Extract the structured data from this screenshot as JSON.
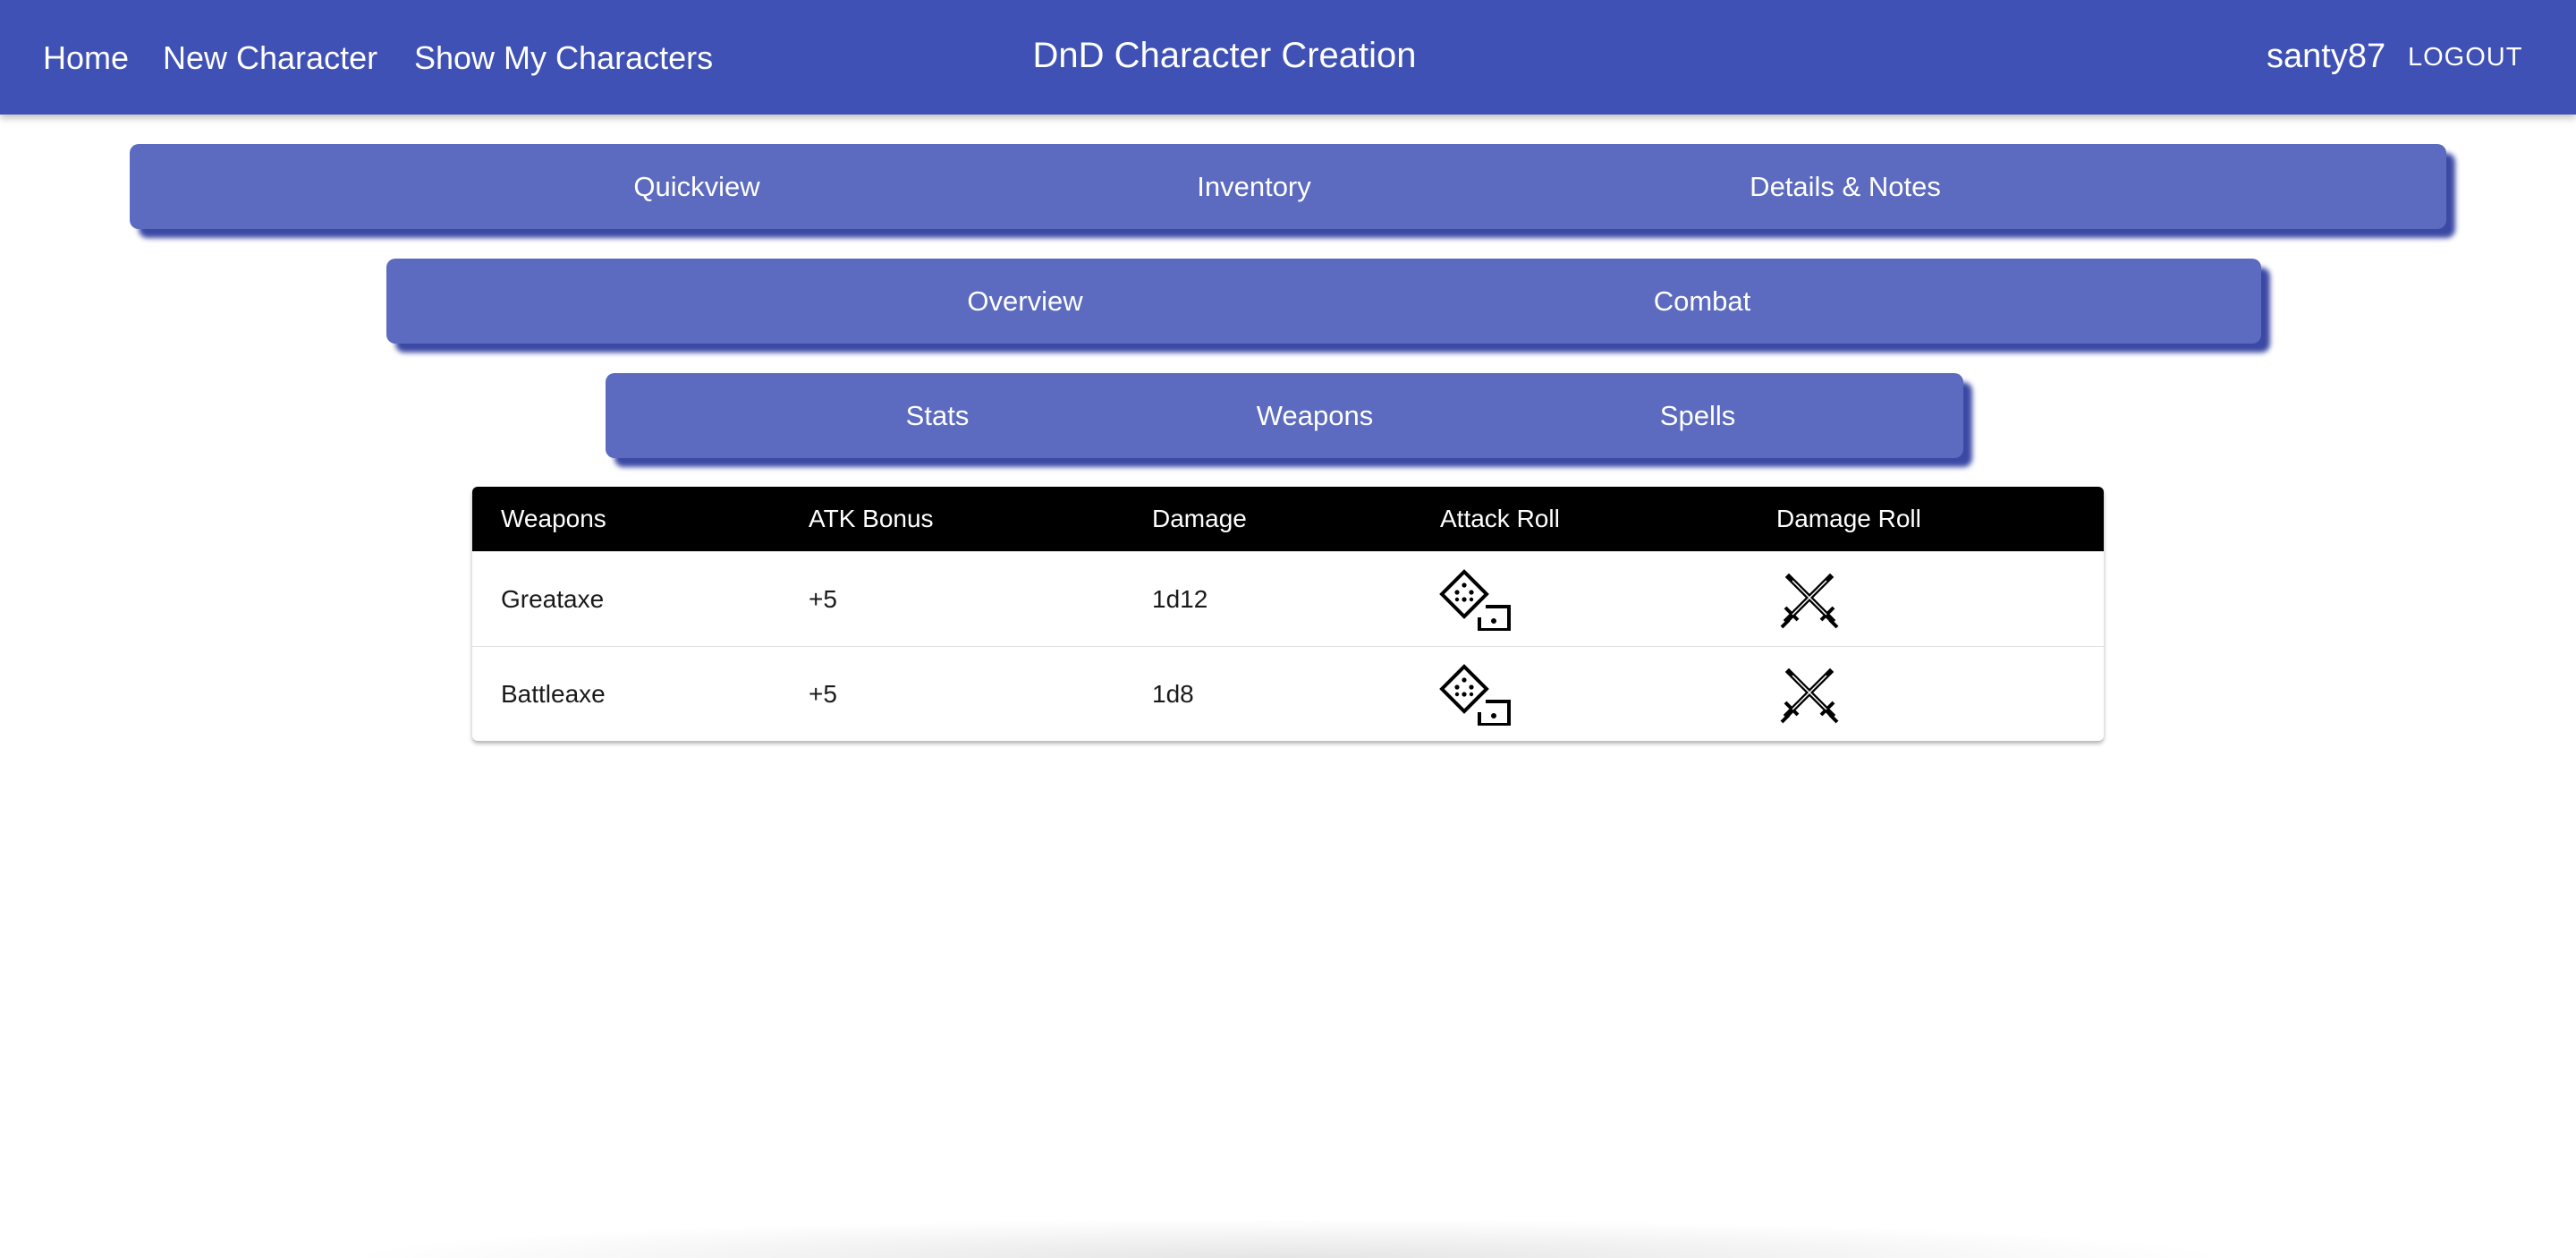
{
  "appbar": {
    "nav": [
      {
        "label": "Home"
      },
      {
        "label": "New Character"
      },
      {
        "label": "Show My Characters"
      }
    ],
    "title": "DnD Character Creation",
    "username": "santy87",
    "logout_label": "LOGOUT",
    "color": "#3f51b5"
  },
  "tabs_primary": [
    {
      "label": "Quickview"
    },
    {
      "label": "Inventory"
    },
    {
      "label": "Details & Notes"
    }
  ],
  "tabs_secondary": [
    {
      "label": "Overview"
    },
    {
      "label": "Combat"
    }
  ],
  "tabs_tertiary": [
    {
      "label": "Stats"
    },
    {
      "label": "Weapons"
    },
    {
      "label": "Spells"
    }
  ],
  "tab_color": "#5c6bc0",
  "weapons_table": {
    "headers": [
      "Weapons",
      "ATK Bonus",
      "Damage",
      "Attack Roll",
      "Damage Roll"
    ],
    "rows": [
      {
        "weapon": "Greataxe",
        "atk_bonus": "+5",
        "damage": "1d12",
        "attack_roll_icon": "dice-icon",
        "damage_roll_icon": "crossed-swords-icon"
      },
      {
        "weapon": "Battleaxe",
        "atk_bonus": "+5",
        "damage": "1d8",
        "attack_roll_icon": "dice-icon",
        "damage_roll_icon": "crossed-swords-icon"
      }
    ]
  }
}
